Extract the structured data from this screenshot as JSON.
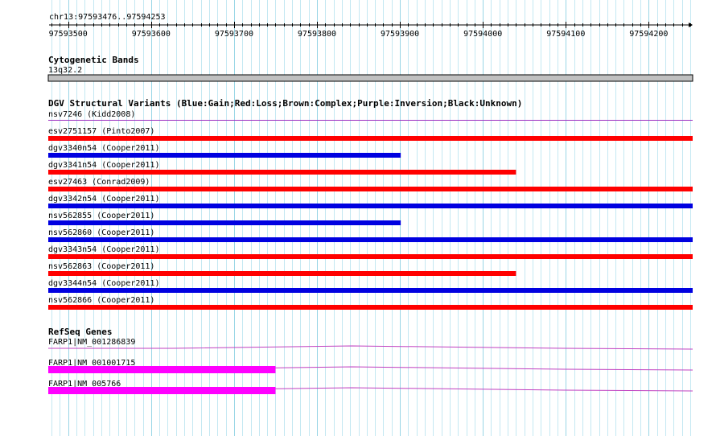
{
  "ruler": {
    "title": "chr13:97593476..97594253",
    "start": 97593476,
    "end": 97594253,
    "major_ticks": [
      97593500,
      97593600,
      97593700,
      97593800,
      97593900,
      97594000,
      97594100,
      97594200
    ],
    "tick_labels": [
      "97593500",
      "97593600",
      "97593700",
      "97593800",
      "97593900",
      "97594000",
      "97594100",
      "97594200"
    ]
  },
  "cytoband": {
    "title": "Cytogenetic Bands",
    "band": "13q32.2",
    "color": "#c0c0c0"
  },
  "dgv": {
    "title": "DGV Structural Variants (Blue:Gain;Red:Loss;Brown:Complex;Purple:Inversion;Black:Unknown)",
    "colors": {
      "gain": "#0000e0",
      "loss": "#ff0000",
      "inversion": "#9b30c0"
    },
    "variants": [
      {
        "label": "nsv7246 (Kidd2008)",
        "type": "inversion",
        "start": 97593476,
        "end": 97594253,
        "thin": true
      },
      {
        "label": "esv2751157 (Pinto2007)",
        "type": "loss",
        "start": 97593476,
        "end": 97594253
      },
      {
        "label": "dgv3340n54 (Cooper2011)",
        "type": "gain",
        "start": 97593476,
        "end": 97593901
      },
      {
        "label": "dgv3341n54 (Cooper2011)",
        "type": "loss",
        "start": 97593476,
        "end": 97594040
      },
      {
        "label": "esv27463 (Conrad2009)",
        "type": "loss",
        "start": 97593476,
        "end": 97594253
      },
      {
        "label": "dgv3342n54 (Cooper2011)",
        "type": "gain",
        "start": 97593476,
        "end": 97594253
      },
      {
        "label": "nsv562855 (Cooper2011)",
        "type": "gain",
        "start": 97593476,
        "end": 97593901
      },
      {
        "label": "nsv562860 (Cooper2011)",
        "type": "gain",
        "start": 97593476,
        "end": 97594253
      },
      {
        "label": "dgv3343n54 (Cooper2011)",
        "type": "loss",
        "start": 97593476,
        "end": 97594253
      },
      {
        "label": "nsv562863 (Cooper2011)",
        "type": "loss",
        "start": 97593476,
        "end": 97594040
      },
      {
        "label": "dgv3344n54 (Cooper2011)",
        "type": "gain",
        "start": 97593476,
        "end": 97594253
      },
      {
        "label": "nsv562866 (Cooper2011)",
        "type": "loss",
        "start": 97593476,
        "end": 97594253
      }
    ]
  },
  "refseq": {
    "title": "RefSeq Genes",
    "color": "#ff00ff",
    "intron_color": "#c040c0",
    "genes": [
      {
        "label": "FARP1|NM_001286839",
        "exon_start": null,
        "exon_end": null
      },
      {
        "label": "FARP1|NM_001001715",
        "exon_start": 97593476,
        "exon_end": 97593750
      },
      {
        "label": "FARP1|NM_005766",
        "exon_start": 97593476,
        "exon_end": 97593750
      }
    ]
  }
}
